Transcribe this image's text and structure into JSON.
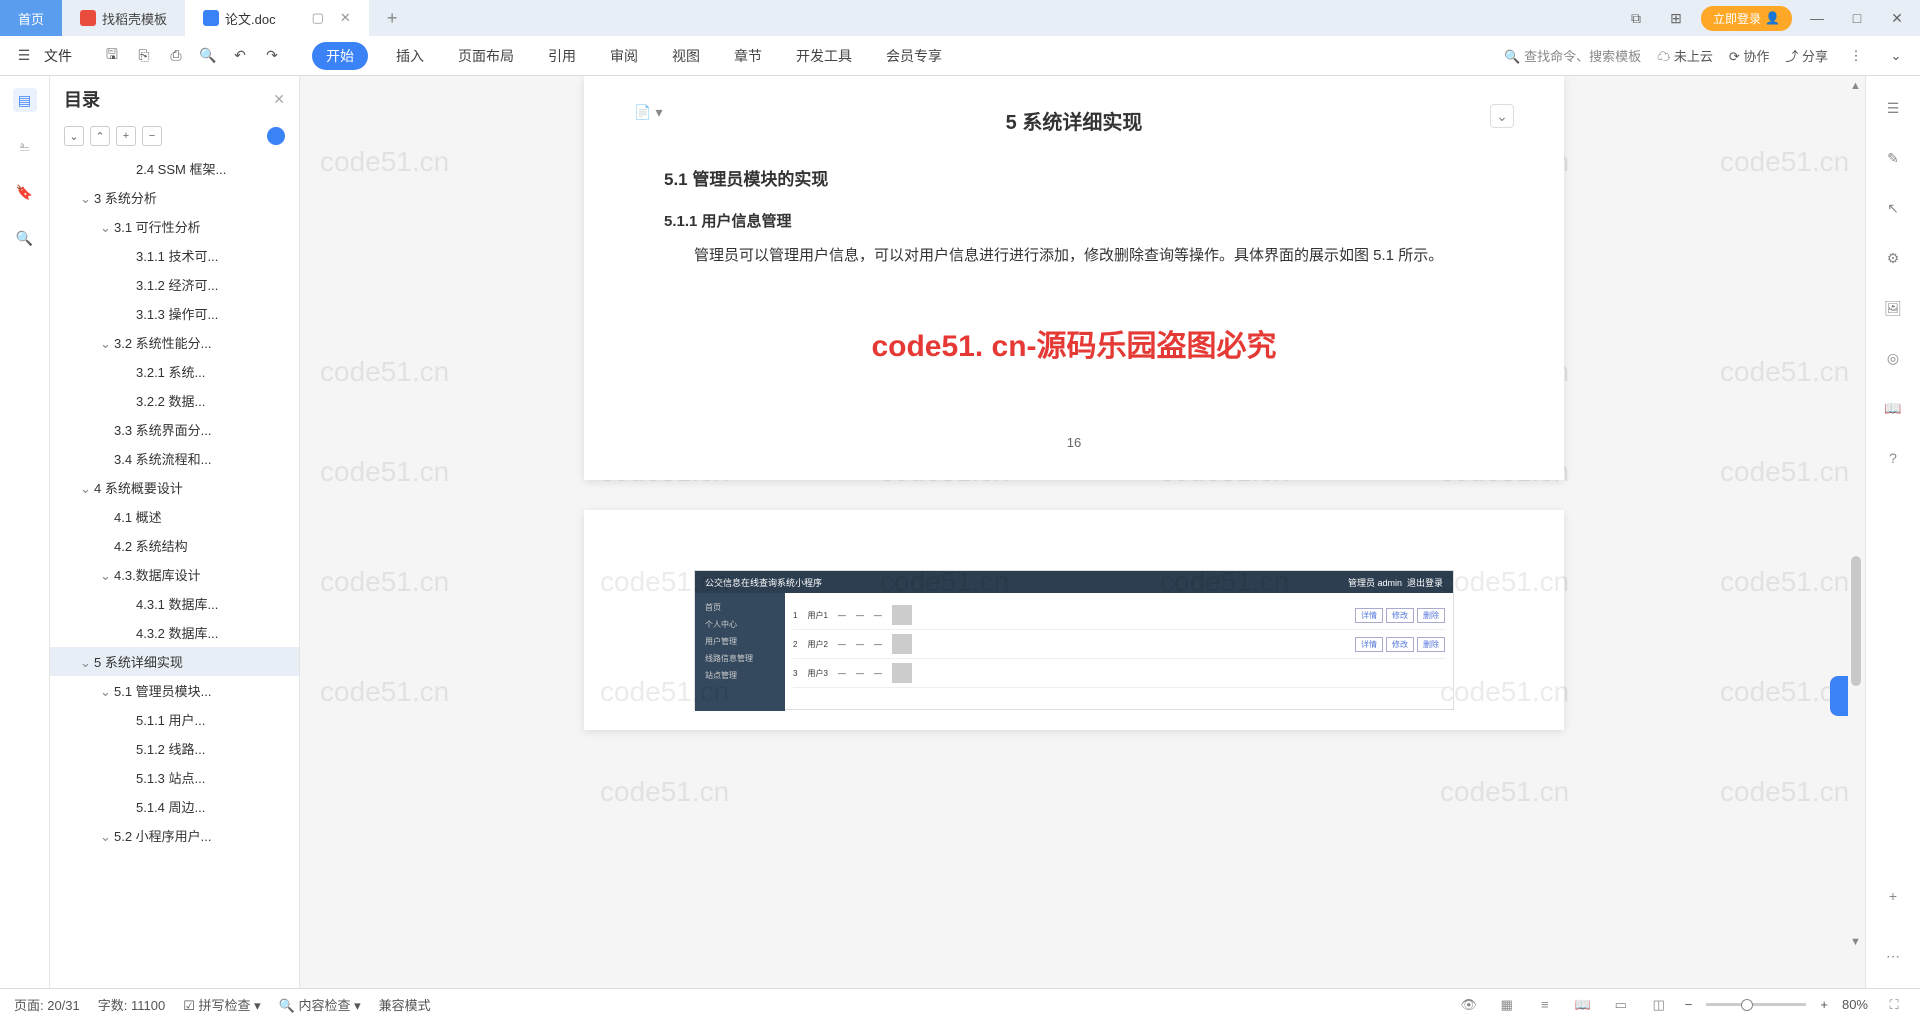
{
  "titlebar": {
    "home": "首页",
    "tab1": "找稻壳模板",
    "tab2": "论文.doc",
    "login": "立即登录"
  },
  "menu": {
    "file": "文件",
    "tabs": [
      "开始",
      "插入",
      "页面布局",
      "引用",
      "审阅",
      "视图",
      "章节",
      "开发工具",
      "会员专享"
    ],
    "search": "查找命令、搜索模板",
    "cloud": "未上云",
    "coop": "协作",
    "share": "分享"
  },
  "outline": {
    "title": "目录",
    "items": [
      {
        "lvl": 3,
        "t": "2.4 SSM 框架..."
      },
      {
        "lvl": 1,
        "t": "3 系统分析",
        "c": 1
      },
      {
        "lvl": 2,
        "t": "3.1 可行性分析",
        "c": 1
      },
      {
        "lvl": 3,
        "t": "3.1.1 技术可..."
      },
      {
        "lvl": 3,
        "t": "3.1.2 经济可..."
      },
      {
        "lvl": 3,
        "t": "3.1.3 操作可..."
      },
      {
        "lvl": 2,
        "t": "3.2 系统性能分...",
        "c": 1
      },
      {
        "lvl": 3,
        "t": "3.2.1 系统..."
      },
      {
        "lvl": 3,
        "t": "3.2.2 数据..."
      },
      {
        "lvl": 2,
        "t": "3.3 系统界面分..."
      },
      {
        "lvl": 2,
        "t": "3.4 系统流程和..."
      },
      {
        "lvl": 1,
        "t": "4 系统概要设计",
        "c": 1
      },
      {
        "lvl": 2,
        "t": "4.1 概述"
      },
      {
        "lvl": 2,
        "t": "4.2 系统结构"
      },
      {
        "lvl": 2,
        "t": "4.3.数据库设计",
        "c": 1
      },
      {
        "lvl": 3,
        "t": "4.3.1 数据库..."
      },
      {
        "lvl": 3,
        "t": "4.3.2 数据库..."
      },
      {
        "lvl": 1,
        "t": "5 系统详细实现",
        "c": 1,
        "sel": 1
      },
      {
        "lvl": 2,
        "t": "5.1 管理员模块...",
        "c": 1
      },
      {
        "lvl": 3,
        "t": "5.1.1 用户..."
      },
      {
        "lvl": 3,
        "t": "5.1.2 线路..."
      },
      {
        "lvl": 3,
        "t": "5.1.3 站点..."
      },
      {
        "lvl": 3,
        "t": "5.1.4 周边..."
      },
      {
        "lvl": 2,
        "t": "5.2 小程序用户...",
        "c": 1
      }
    ]
  },
  "document": {
    "h1": "5 系统详细实现",
    "h2": "5.1  管理员模块的实现",
    "h3": "5.1.1  用户信息管理",
    "p1": "管理员可以管理用户信息，可以对用户信息进行进行添加，修改删除查询等操作。具体界面的展示如图 5.1 所示。",
    "redwm": "code51. cn-源码乐园盗图必究",
    "pagenum": "16",
    "wm": "code51.cn"
  },
  "embed": {
    "title": "公交信息在线查询系统小程序",
    "admin": "管理员 admin",
    "logout": "退出登录",
    "side": [
      "首页",
      "个人中心",
      "用户管理",
      "线路信息管理",
      "站点管理"
    ],
    "btns": [
      "详情",
      "修改",
      "删除"
    ]
  },
  "status": {
    "page": "页面: 20/31",
    "words": "字数: 11100",
    "spell": "拼写检查",
    "content": "内容检查",
    "compat": "兼容模式",
    "zoom": "80%"
  }
}
